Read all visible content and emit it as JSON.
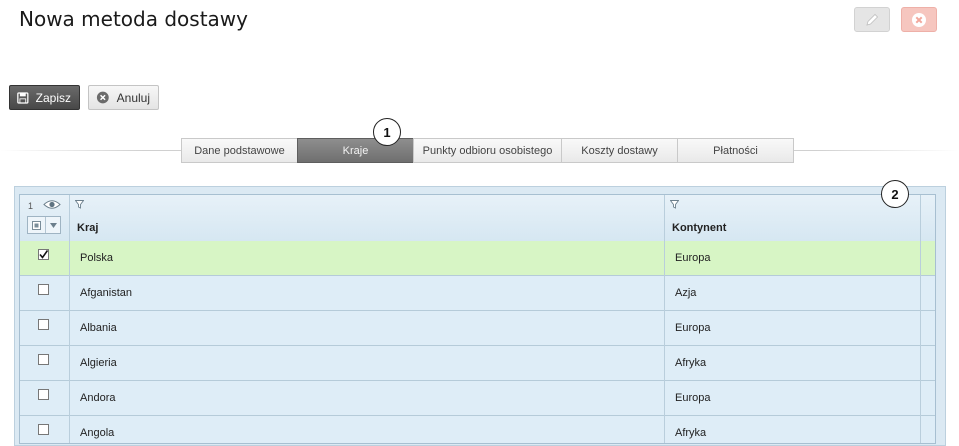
{
  "header": {
    "title": "Nowa metoda dostawy"
  },
  "toolbar": {
    "save_label": "Zapisz",
    "cancel_label": "Anuluj"
  },
  "tabs": [
    {
      "label": "Dane podstawowe",
      "active": false
    },
    {
      "label": "Kraje",
      "active": true
    },
    {
      "label": "Punkty odbioru osobistego",
      "active": false
    },
    {
      "label": "Koszty dostawy",
      "active": false
    },
    {
      "label": "Płatności",
      "active": false
    }
  ],
  "callouts": [
    "1",
    "2"
  ],
  "grid": {
    "visible_columns_count": "1",
    "columns": [
      "Kraj",
      "Kontynent"
    ],
    "rows": [
      {
        "checked": true,
        "country": "Polska",
        "continent": "Europa"
      },
      {
        "checked": false,
        "country": "Afganistan",
        "continent": "Azja"
      },
      {
        "checked": false,
        "country": "Albania",
        "continent": "Europa"
      },
      {
        "checked": false,
        "country": "Algieria",
        "continent": "Afryka"
      },
      {
        "checked": false,
        "country": "Andora",
        "continent": "Europa"
      },
      {
        "checked": false,
        "country": "Angola",
        "continent": "Afryka"
      }
    ]
  },
  "colors": {
    "selected_row": "#d7f5c5",
    "row": "#deedf7",
    "active_tab": "#7f7f7f"
  },
  "icons": {
    "save": "floppy-disk-icon",
    "cancel": "x-circle-icon",
    "edit": "pencil-icon",
    "close": "x-circle-icon",
    "columns": "eye-icon",
    "filter": "filter-icon"
  }
}
